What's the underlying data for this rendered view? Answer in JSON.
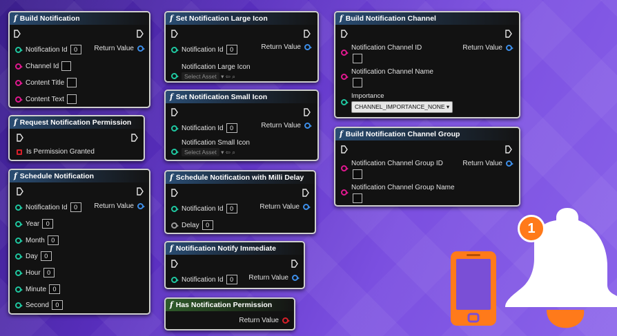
{
  "pins": {
    "return_value": "Return Value",
    "notification_id": "Notification Id",
    "zero": "0",
    "select_asset": "Select Asset"
  },
  "nodes": {
    "build_notification": {
      "title": "Build Notification",
      "inputs": [
        "Channel Id",
        "Content Title",
        "Content Text"
      ]
    },
    "request_permission": {
      "title": "Request Notification Permission",
      "output": "Is Permission Granted"
    },
    "schedule_notification": {
      "title": "Schedule Notification",
      "inputs": [
        "Year",
        "Month",
        "Day",
        "Hour",
        "Minute",
        "Second"
      ]
    },
    "set_large_icon": {
      "title": "Set Notification Large Icon",
      "icon_label": "Notification Large Icon"
    },
    "set_small_icon": {
      "title": "Set Notification Small Icon",
      "icon_label": "Notification Small Icon"
    },
    "schedule_milli": {
      "title": "Schedule Notification with Milli Delay",
      "delay_label": "Delay"
    },
    "notify_immediate": {
      "title": "Notification Notify Immediate"
    },
    "has_permission": {
      "title": "Has Notification Permission"
    },
    "build_channel": {
      "title": "Build Notification Channel",
      "inputs": [
        "Notification Channel ID",
        "Notification Channel Name"
      ],
      "importance_label": "Importance",
      "importance_value": "CHANNEL_IMPORTANCE_NONE"
    },
    "build_channel_group": {
      "title": "Build Notification Channel Group",
      "inputs": [
        "Notification Channel Group ID",
        "Notification Channel Group Name"
      ]
    }
  },
  "badge": {
    "count": "1"
  },
  "colors": {
    "phone_orange": "#ff7a1a",
    "bell_white": "#ffffff",
    "pin_teal": "#1fc7a0",
    "pin_magenta": "#e0188f",
    "pin_blue": "#3d8ee8",
    "pin_red": "#d8202a"
  }
}
